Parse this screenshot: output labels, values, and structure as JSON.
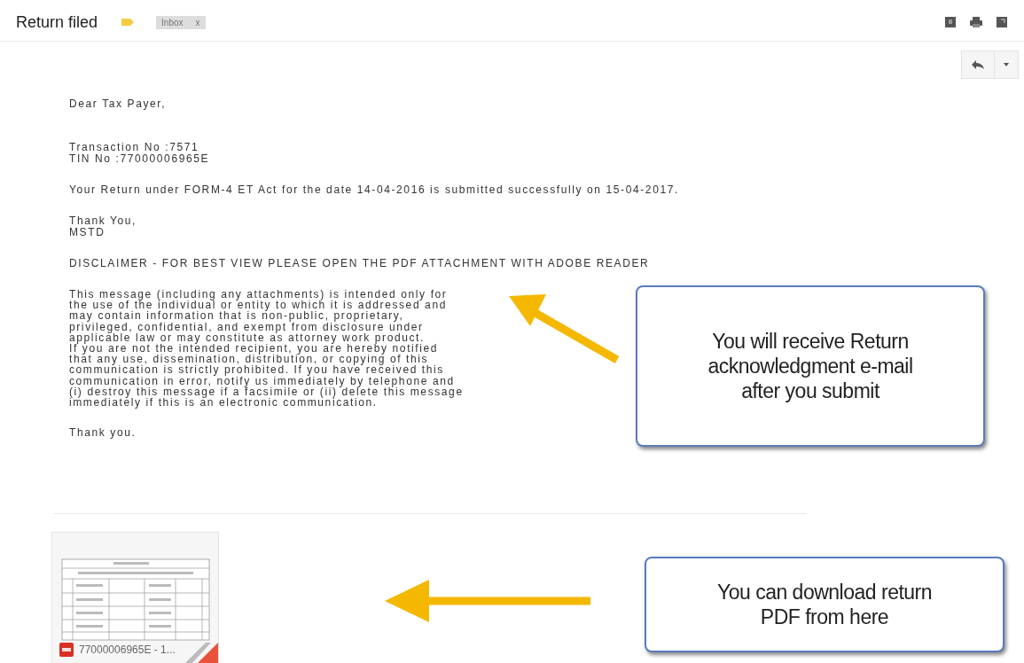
{
  "subject": {
    "title": "Return filed",
    "label_chip": {
      "text": "Inbox",
      "close": "x"
    }
  },
  "message": {
    "greeting": "Dear Tax Payer,",
    "details": [
      "Transaction No :7571",
      "TIN No :77000006965E"
    ],
    "statement": "Your Return under FORM-4 ET Act for the date 14-04-2016 is submitted successfully on 15-04-2017.",
    "closing": [
      "Thank You,",
      "MSTD"
    ],
    "disclaimer_heading": "DISCLAIMER - FOR BEST VIEW PLEASE OPEN THE PDF ATTACHMENT WITH ADOBE READER",
    "disclaimer": "This message (including any attachments) is intended only for\nthe use of the individual or entity to which it is addressed and\nmay contain information that is non-public, proprietary,\nprivileged, confidential, and exempt from disclosure under\napplicable law or may constitute as attorney work product.\nIf you are not the intended recipient, you are hereby notified\nthat any use, dissemination, distribution, or copying of this\ncommunication is strictly prohibited. If you have received this\ncommunication in error, notify us immediately by telephone and\n(i) destroy this message if a facsimile or (ii) delete this message\nimmediately if this is an electronic communication.",
    "sign_off": "Thank you."
  },
  "attachment": {
    "name": "77000006965E - 1..."
  },
  "callouts": [
    {
      "text": "You will receive Return\nacknowledgment e-mail\nafter you submit"
    },
    {
      "text": "You can download return\nPDF from here"
    }
  ]
}
